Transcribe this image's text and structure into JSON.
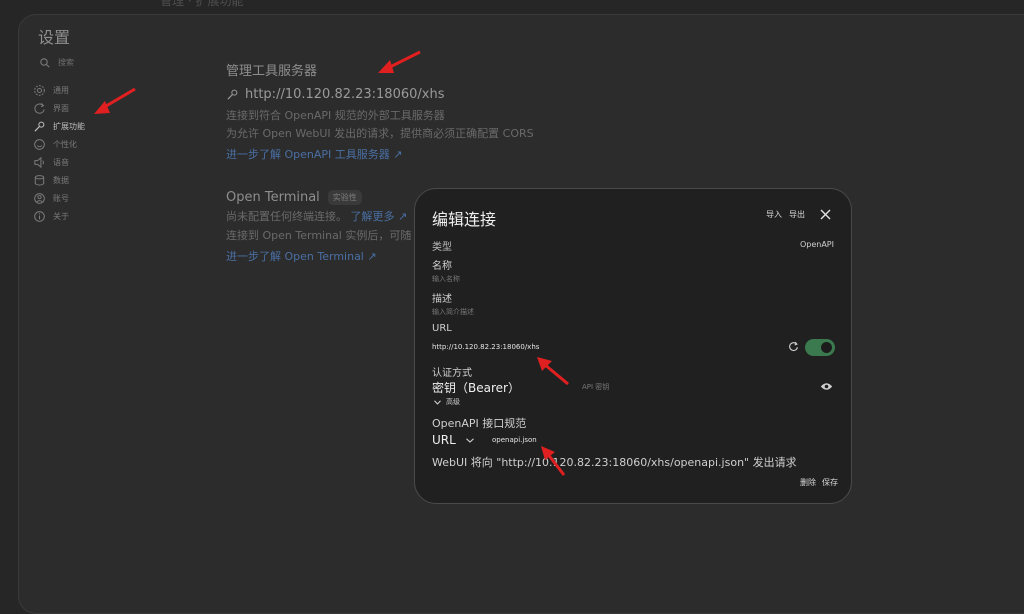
{
  "top_partial": "管理 · 扩展功能",
  "settings": {
    "title": "设置",
    "search_placeholder": "搜索",
    "nav": [
      {
        "label": "通用",
        "icon": "gear-icon"
      },
      {
        "label": "界面",
        "icon": "refresh-icon"
      },
      {
        "label": "扩展功能",
        "icon": "wrench-icon",
        "active": true
      },
      {
        "label": "个性化",
        "icon": "smile-icon"
      },
      {
        "label": "语音",
        "icon": "speaker-icon"
      },
      {
        "label": "数据",
        "icon": "database-icon"
      },
      {
        "label": "账号",
        "icon": "user-icon"
      },
      {
        "label": "关于",
        "icon": "info-icon"
      }
    ]
  },
  "tool_server": {
    "title": "管理工具服务器",
    "url": "http://10.120.82.23:18060/xhs",
    "desc1": "连接到符合 OpenAPI 规范的外部工具服务器",
    "desc2": "为允许 Open WebUI 发出的请求，提供商必须正确配置 CORS",
    "link": "进一步了解 OpenAPI 工具服务器 ↗"
  },
  "open_terminal": {
    "title": "Open Terminal",
    "badge": "实验性",
    "desc1": "尚未配置任何终端连接。",
    "desc1_link": "了解更多 ↗",
    "desc2": "连接到 Open Terminal 实例后，可随",
    "link": "进一步了解 Open Terminal ↗"
  },
  "dialog": {
    "title": "编辑连接",
    "import": "导入",
    "export": "导出",
    "type_label": "类型",
    "type_value": "OpenAPI",
    "name_label": "名称",
    "name_placeholder": "输入名称",
    "desc_label": "描述",
    "desc_placeholder": "输入简介描述",
    "url_label": "URL",
    "url_value": "http://10.120.82.23:18060/xhs",
    "url_enabled": true,
    "auth_label": "认证方式",
    "auth_value": "密钥（Bearer）",
    "key_placeholder": "API 密钥",
    "advanced": "高级",
    "spec_label": "OpenAPI 接口规范",
    "spec_mode": "URL",
    "spec_path": "openapi.json",
    "note": "WebUI 将向 \"http://10.120.82.23:18060/xhs/openapi.json\" 发出请求",
    "delete": "删除",
    "save": "保存"
  },
  "colors": {
    "accent_link": "#4a6fa4",
    "toggle_on": "#3b7a4e",
    "annotation_arrow": "#e02020"
  }
}
